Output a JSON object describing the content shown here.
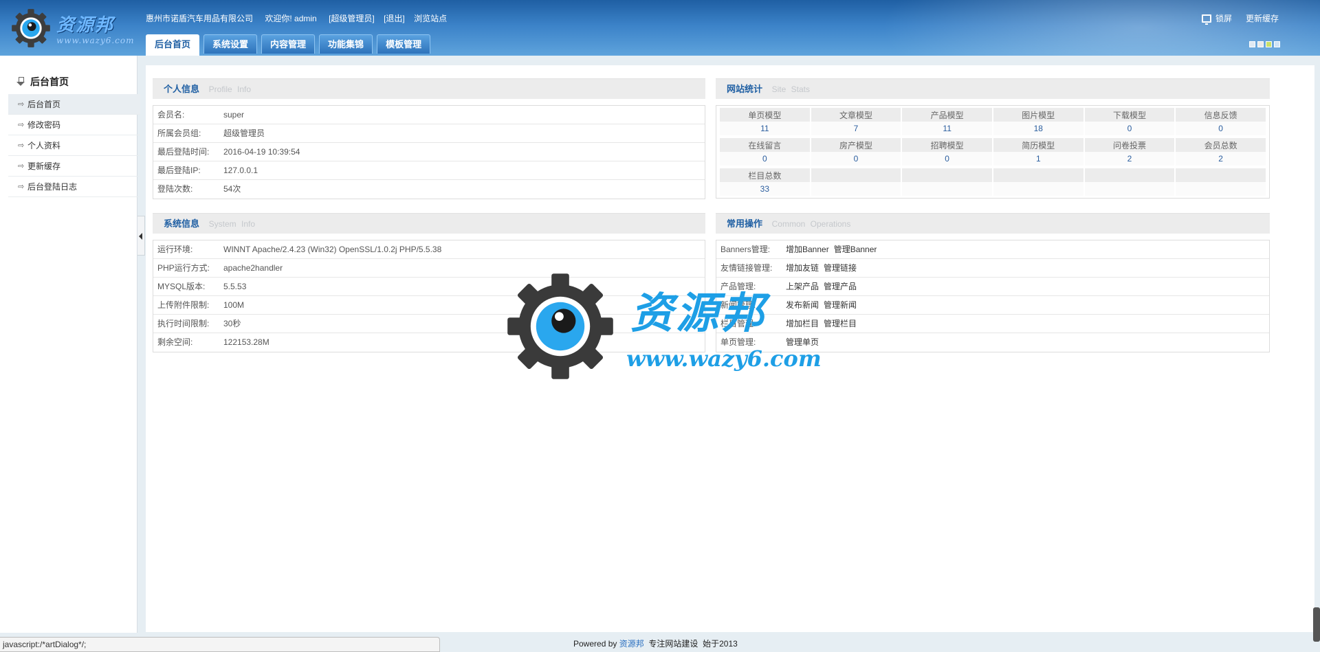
{
  "header": {
    "logo_text": "资源邦",
    "logo_url": "www.wazy6.com",
    "company": "惠州市诺盾汽车用品有限公司",
    "welcome": "欢迎你! admin",
    "role_link": "[超级管理员]",
    "logout_link": "[退出]",
    "browse_link": "浏览站点",
    "lock_label": "锁屏",
    "cache_label": "更新缓存",
    "skin_colors": [
      "#dfe9f3",
      "#e8e8e8",
      "#c8e06a",
      "#cfe3f6"
    ]
  },
  "nav": {
    "tabs": [
      {
        "label": "后台首页",
        "active": true
      },
      {
        "label": "系统设置"
      },
      {
        "label": "内容管理"
      },
      {
        "label": "功能集锦"
      },
      {
        "label": "模板管理"
      }
    ]
  },
  "sidebar": {
    "title": "后台首页",
    "items": [
      {
        "label": "后台首页",
        "active": true
      },
      {
        "label": "修改密码"
      },
      {
        "label": "个人资料"
      },
      {
        "label": "更新缓存"
      },
      {
        "label": "后台登陆日志"
      }
    ]
  },
  "profile": {
    "title": "个人信息",
    "title_en": "Profile  Info",
    "rows": [
      {
        "k": "会员名:",
        "v": "super"
      },
      {
        "k": "所属会员组:",
        "v": "超级管理员"
      },
      {
        "k": "最后登陆时间:",
        "v": "2016-04-19 10:39:54"
      },
      {
        "k": "最后登陆IP:",
        "v": "127.0.0.1"
      },
      {
        "k": "登陆次数:",
        "v": "54次"
      }
    ]
  },
  "stats": {
    "title": "网站统计",
    "title_en": "Site  Stats",
    "row1": {
      "heads": [
        "单页模型",
        "文章模型",
        "产品模型",
        "图片模型",
        "下载模型",
        "信息反馈"
      ],
      "values": [
        "11",
        "7",
        "11",
        "18",
        "0",
        "0"
      ]
    },
    "row2": {
      "heads": [
        "在线留言",
        "房产模型",
        "招聘模型",
        "简历模型",
        "问卷投票",
        "会员总数"
      ],
      "values": [
        "0",
        "0",
        "0",
        "1",
        "2",
        "2"
      ]
    },
    "row3": {
      "heads": [
        "栏目总数",
        "",
        "",
        "",
        "",
        ""
      ],
      "values": [
        "33",
        "",
        "",
        "",
        "",
        ""
      ]
    }
  },
  "sysinfo": {
    "title": "系统信息",
    "title_en": "System  Info",
    "rows": [
      {
        "k": "运行环境:",
        "v": "WINNT Apache/2.4.23 (Win32) OpenSSL/1.0.2j PHP/5.5.38"
      },
      {
        "k": "PHP运行方式:",
        "v": "apache2handler"
      },
      {
        "k": "MYSQL版本:",
        "v": "5.5.53"
      },
      {
        "k": "上传附件限制:",
        "v": "100M"
      },
      {
        "k": "执行时间限制:",
        "v": "30秒"
      },
      {
        "k": "剩余空间:",
        "v": "122153.28M"
      }
    ]
  },
  "ops": {
    "title": "常用操作",
    "title_en": "Common  Operations",
    "rows": [
      {
        "k": "Banners管理:",
        "links": [
          "增加Banner",
          "管理Banner"
        ]
      },
      {
        "k": "友情链接管理:",
        "links": [
          "增加友链",
          "管理链接"
        ]
      },
      {
        "k": "产品管理:",
        "links": [
          "上架产品",
          "管理产品"
        ]
      },
      {
        "k": "新闻管理:",
        "links": [
          "发布新闻",
          "管理新闻"
        ]
      },
      {
        "k": "栏目管理:",
        "links": [
          "增加栏目",
          "管理栏目"
        ]
      },
      {
        "k": "单页管理:",
        "links": [
          "管理单页"
        ]
      }
    ]
  },
  "watermark": {
    "text": "资源邦",
    "url": "www.wazy6.com"
  },
  "footer": {
    "powered": "Powered by",
    "brand": "资源邦",
    "slogan": "专注网站建设",
    "since": "始于2013"
  },
  "statusbar": {
    "text": "javascript:/*artDialog*/;"
  }
}
